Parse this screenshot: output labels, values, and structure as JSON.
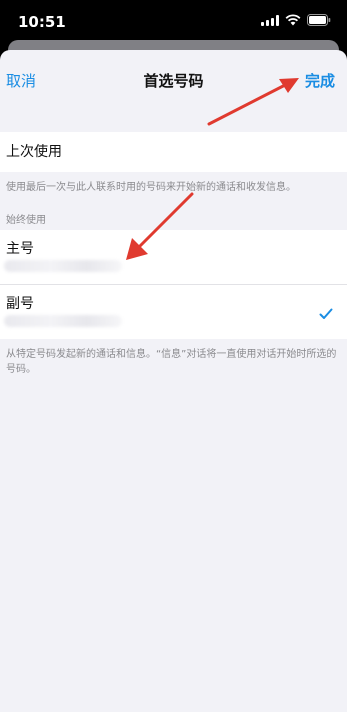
{
  "status_bar": {
    "time": "10:51"
  },
  "nav": {
    "cancel_label": "取消",
    "title": "首选号码",
    "done_label": "完成"
  },
  "last_used": {
    "label": "上次使用",
    "footer": "使用最后一次与此人联系时用的号码来开始新的通话和收发信息。"
  },
  "always_use": {
    "header": "始终使用",
    "options": [
      {
        "label": "主号",
        "selected": false
      },
      {
        "label": "副号",
        "selected": true
      }
    ],
    "footer": "从特定号码发起新的通话和信息。“信息”对话将一直使用对话开始时所选的号码。"
  },
  "colors": {
    "accent": "#1a8de3",
    "annotation_arrow": "#e03a2f"
  }
}
